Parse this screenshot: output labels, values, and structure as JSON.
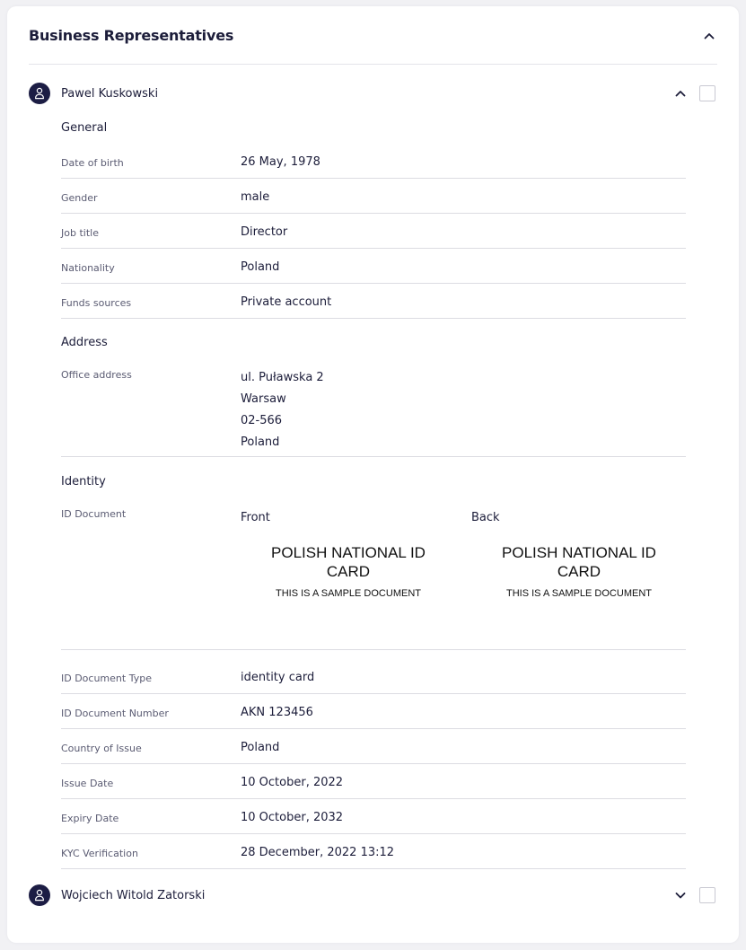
{
  "panel": {
    "title": "Business Representatives"
  },
  "representatives": [
    {
      "name": "Pawel Kuskowski",
      "expanded": true,
      "general": {
        "title": "General",
        "rows": [
          {
            "label": "Date of birth",
            "value": "26 May, 1978"
          },
          {
            "label": "Gender",
            "value": "male"
          },
          {
            "label": "Job title",
            "value": "Director"
          },
          {
            "label": "Nationality",
            "value": "Poland"
          },
          {
            "label": "Funds sources",
            "value": "Private account"
          }
        ]
      },
      "address": {
        "title": "Address",
        "label": "Office address",
        "lines": [
          "ul. Puławska 2",
          "Warsaw",
          "02-566",
          "Poland"
        ]
      },
      "identity": {
        "title": "Identity",
        "doc_label": "ID Document",
        "front": {
          "label": "Front",
          "card_title": "POLISH NATIONAL ID CARD",
          "card_subtitle": "THIS IS A SAMPLE DOCUMENT"
        },
        "back": {
          "label": "Back",
          "card_title": "POLISH NATIONAL ID CARD",
          "card_subtitle": "THIS IS A SAMPLE DOCUMENT"
        },
        "rows": [
          {
            "label": "ID Document Type",
            "value": "identity card"
          },
          {
            "label": "ID Document Number",
            "value": "AKN 123456"
          },
          {
            "label": "Country of Issue",
            "value": "Poland"
          },
          {
            "label": "Issue Date",
            "value": "10 October, 2022"
          },
          {
            "label": "Expiry Date",
            "value": "10 October, 2032"
          },
          {
            "label": "KYC Verification",
            "value": "28 December, 2022 13:12"
          }
        ]
      }
    },
    {
      "name": "Wojciech Witold Zatorski",
      "expanded": false
    }
  ],
  "icons": {
    "collapse": "chevron-up-icon",
    "expand": "chevron-down-icon",
    "avatar": "user-icon"
  },
  "colors": {
    "accent": "#1c1d44",
    "divider": "#dcdce2"
  }
}
